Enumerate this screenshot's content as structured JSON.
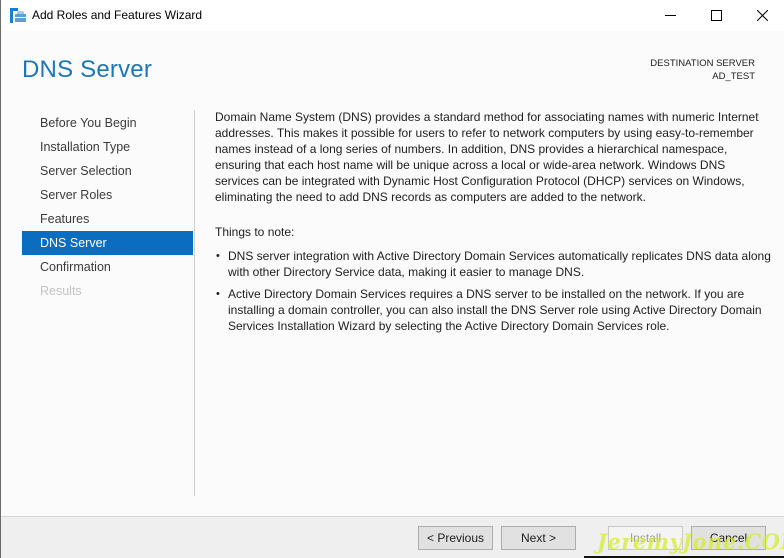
{
  "window": {
    "title": "Add Roles and Features Wizard",
    "controls": {
      "minimize": "minimize",
      "maximize": "maximize",
      "close": "close"
    }
  },
  "header": {
    "page_title": "DNS Server",
    "destination_label": "DESTINATION SERVER",
    "destination_value": "AD_TEST",
    "accent_color": "#1f76b4"
  },
  "nav": {
    "items": [
      {
        "label": "Before You Begin",
        "state": "normal"
      },
      {
        "label": "Installation Type",
        "state": "normal"
      },
      {
        "label": "Server Selection",
        "state": "normal"
      },
      {
        "label": "Server Roles",
        "state": "normal"
      },
      {
        "label": "Features",
        "state": "normal"
      },
      {
        "label": "DNS Server",
        "state": "active"
      },
      {
        "label": "Confirmation",
        "state": "normal"
      },
      {
        "label": "Results",
        "state": "disabled"
      }
    ],
    "active_color": "#0a6dbf"
  },
  "content": {
    "intro": "Domain Name System (DNS) provides a standard method for associating names with numeric Internet addresses. This makes it possible for users to refer to network computers by using easy-to-remember names instead of a long series of numbers. In addition, DNS provides a hierarchical namespace, ensuring that each host name will be unique across a local or wide-area network. Windows DNS services can be integrated with Dynamic Host Configuration Protocol (DHCP) services on Windows, eliminating the need to add DNS records as computers are added to the network.",
    "notes_label": "Things to note:",
    "bullet_glyph": "•",
    "notes": [
      "DNS server integration with Active Directory Domain Services automatically replicates DNS data along with other Directory Service data, making it easier to manage DNS.",
      "Active Directory Domain Services requires a DNS server to be installed on the network. If you are installing a domain controller, you can also install the DNS Server role using Active Directory Domain Services Installation Wizard by selecting the Active Directory Domain Services role."
    ]
  },
  "footer": {
    "previous_label": "< Previous",
    "next_label": "Next >",
    "install_label": "Install",
    "install_enabled": false,
    "cancel_label": "Cancel"
  },
  "watermark": {
    "text": "JeremyJone.COM"
  }
}
